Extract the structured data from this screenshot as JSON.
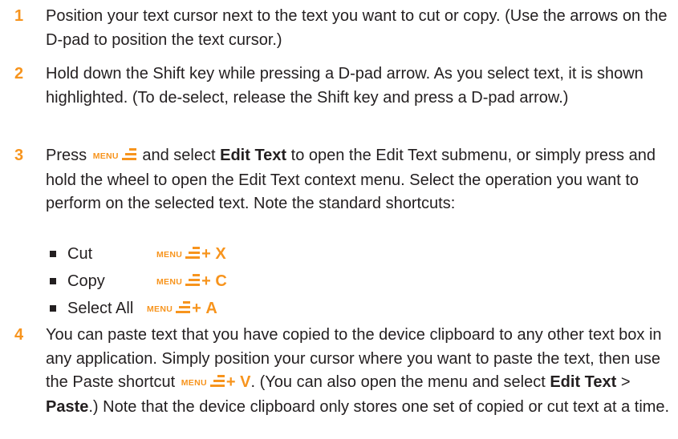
{
  "steps": [
    {
      "number": "1",
      "text": "Position your text cursor next to the text you want to cut or copy. (Use the arrows on the D-pad to position the text cursor.)"
    },
    {
      "number": "2",
      "text": "Hold down the Shift key while pressing a D-pad arrow. As you select text, it is shown highlighted. (To de-select, release the Shift key and press a D-pad arrow.)"
    },
    {
      "number": "3",
      "text_before": "Press",
      "menu_label": "MENU",
      "text_middle": "and select",
      "bold_edit_text": "Edit Text",
      "text_after": "to open the Edit Text submenu, or simply press and hold the wheel to open the Edit Text context menu. Select the operation you want to perform on the selected text. Note the standard shortcuts:",
      "shortcuts": [
        {
          "label": "Cut",
          "menu_label": "MENU",
          "plus": "+",
          "key": "X"
        },
        {
          "label": "Copy",
          "menu_label": "MENU",
          "plus": "+",
          "key": "C"
        },
        {
          "label": "Select All",
          "menu_label": "MENU",
          "plus": "+",
          "key": "A"
        }
      ]
    },
    {
      "number": "4",
      "text_before": "You can paste text that you have copied to the device clipboard to any other text box in any application. Simply position your cursor where you want to paste the text, then use the Paste shortcut",
      "menu_label": "MENU",
      "plus": "+",
      "key": "V",
      "text_middle": ". (You can also open the menu and select",
      "bold_edit_text": "Edit Text",
      "separator": ">",
      "bold_paste": "Paste",
      "text_after": ".) Note that the device clipboard only stores one set of copied or cut text at a time."
    }
  ],
  "colors": {
    "accent": "#f7941d",
    "text": "#231f20"
  },
  "icons": {
    "menu": "menu-icon"
  }
}
